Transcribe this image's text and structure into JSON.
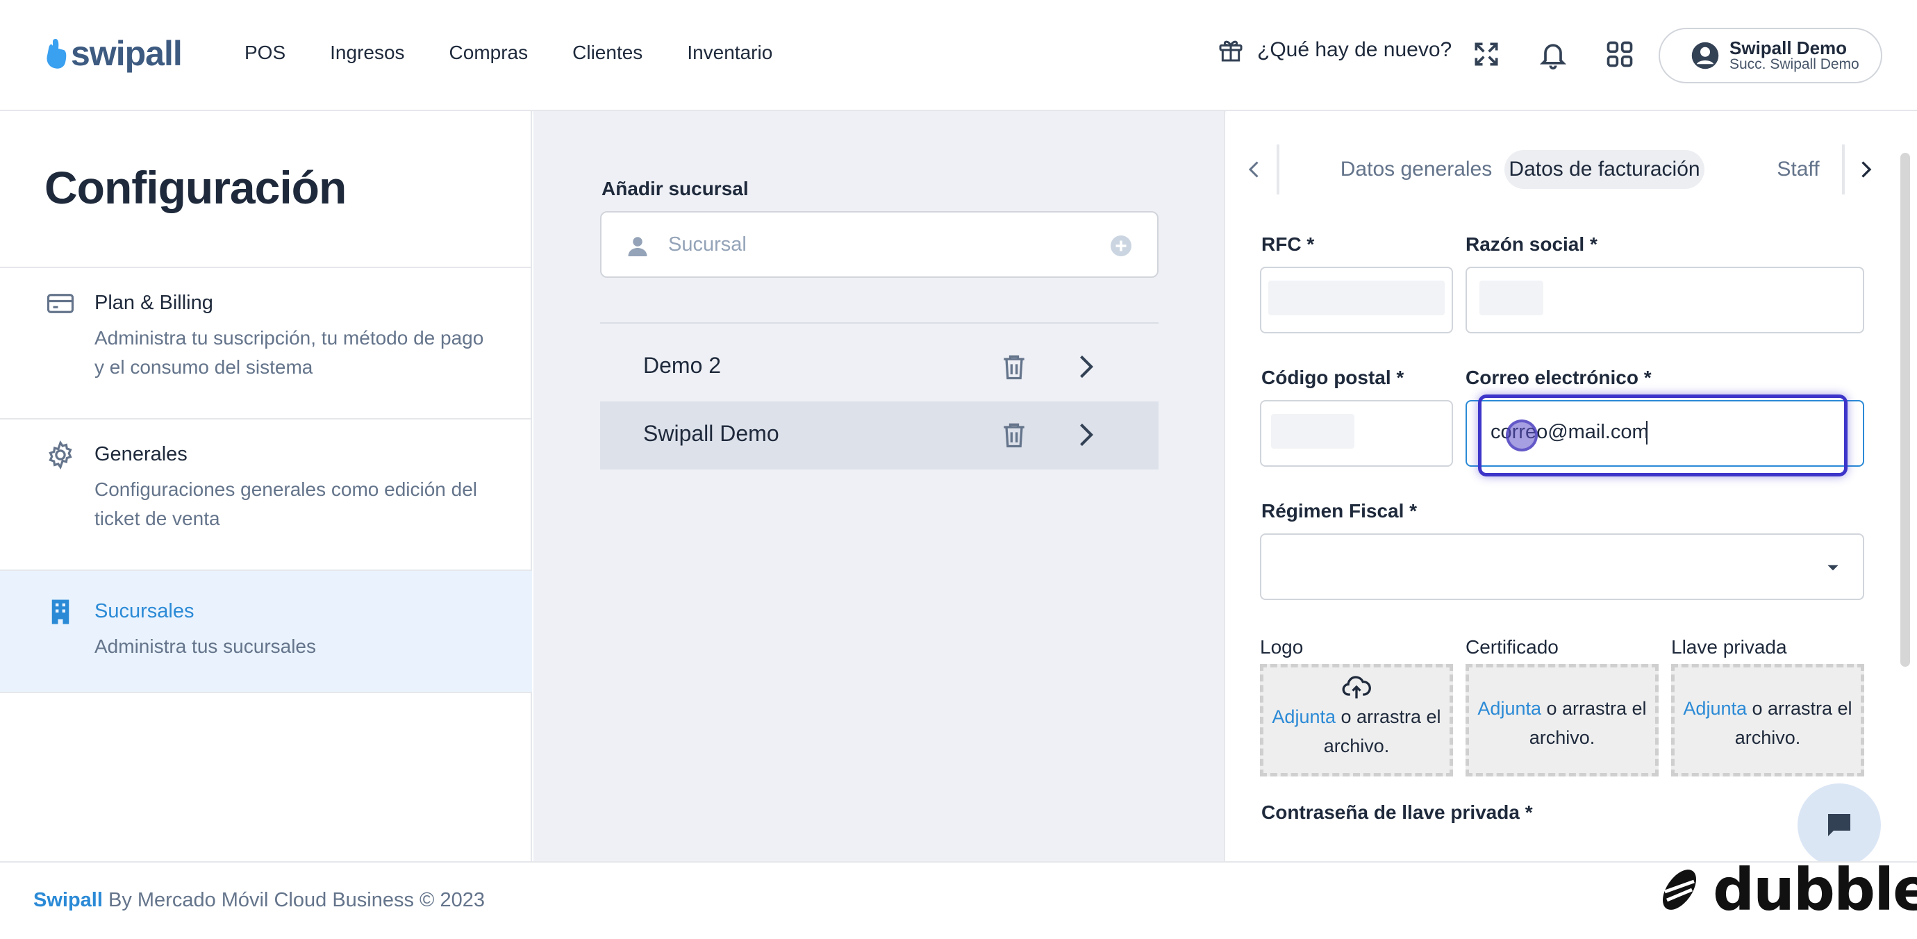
{
  "app": {
    "logo_text": "swipall",
    "nav": [
      "POS",
      "Ingresos",
      "Compras",
      "Clientes",
      "Inventario"
    ],
    "whats_new": "¿Qué hay de nuevo?",
    "user": {
      "name": "Swipall Demo",
      "branch": "Succ. Swipall Demo"
    },
    "icons": [
      "gift-icon",
      "fullscreen-icon",
      "bell-icon",
      "apps-grid-icon",
      "user-avatar-icon"
    ]
  },
  "sidebar": {
    "title": "Configuración",
    "items": [
      {
        "title": "Plan & Billing",
        "desc": "Administra tu suscripción, tu método de pago y el consumo del sistema",
        "icon": "credit-card-icon"
      },
      {
        "title": "Generales",
        "desc": "Configuraciones generales como edición del ticket de venta",
        "icon": "gear-icon"
      },
      {
        "title": "Sucursales",
        "desc": "Administra tus sucursales",
        "icon": "building-icon",
        "active": true
      }
    ]
  },
  "branches": {
    "add_label": "Añadir sucursal",
    "placeholder": "Sucursal",
    "list": [
      {
        "name": "Demo 2"
      },
      {
        "name": "Swipall Demo",
        "selected": true
      }
    ]
  },
  "form": {
    "tabs": [
      "Datos generales",
      "Datos de facturación",
      "Staff"
    ],
    "active_tab": "Datos de facturación",
    "rfc_label": "RFC *",
    "razon_label": "Razón social *",
    "cp_label": "Código postal *",
    "email_label": "Correo electrónico *",
    "email_value": "correo@mail.com",
    "regimen_label": "Régimen Fiscal *",
    "uploads": [
      {
        "label": "Logo",
        "link": "Adjunta",
        "text": " o arrastra el archivo."
      },
      {
        "label": "Certificado",
        "link": "Adjunta",
        "text": " o arrastra el archivo."
      },
      {
        "label": "Llave privada",
        "link": "Adjunta",
        "text": " o arrastra el archivo."
      }
    ],
    "password_label": "Contraseña de llave privada *"
  },
  "footer": {
    "brand": "Swipall",
    "text": " By Mercado Móvil Cloud Business © 2023"
  },
  "watermark": "dubble",
  "colors": {
    "accent": "#2b8ad6",
    "focus": "#3d35c9",
    "active_bg": "#eaf3fd"
  }
}
